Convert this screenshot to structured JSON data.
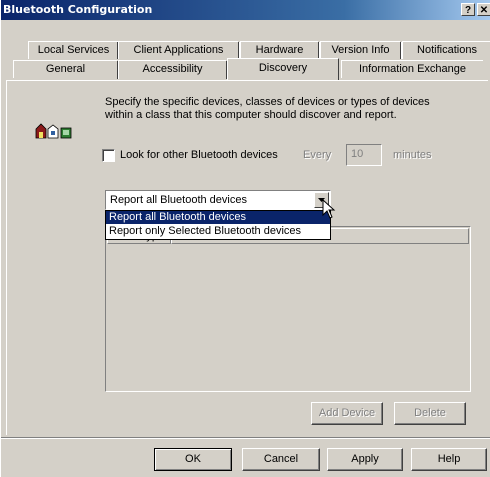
{
  "window": {
    "title": "Bluetooth Configuration",
    "help_glyph": "?",
    "close_glyph": "✕"
  },
  "tabs_top": [
    {
      "label": "Local Services"
    },
    {
      "label": "Client Applications"
    },
    {
      "label": "Hardware"
    },
    {
      "label": "Version Info"
    },
    {
      "label": "Notifications"
    }
  ],
  "tabs_bottom": [
    {
      "label": "General"
    },
    {
      "label": "Accessibility"
    },
    {
      "label": "Discovery"
    },
    {
      "label": "Information Exchange"
    }
  ],
  "selected_tab": "Discovery",
  "discovery": {
    "description": "Specify the specific devices, classes of devices or types of devices within a class that this computer should discover and report.",
    "look_for_label": "Look for other Bluetooth devices",
    "look_for_checked": false,
    "every_label": "Every",
    "every_value": "10",
    "minutes_label": "minutes",
    "dropdown_value": "Report all Bluetooth devices",
    "dropdown_options": [
      "Report all Bluetooth devices",
      "Report only Selected Bluetooth devices"
    ],
    "dropdown_open": true,
    "highlighted_option": 0,
    "list_columns": [
      "Filter Type",
      "Details"
    ],
    "add_device_label": "Add Device",
    "delete_label": "Delete"
  },
  "buttons": {
    "ok": "OK",
    "cancel": "Cancel",
    "apply": "Apply",
    "help": "Help"
  },
  "colors": {
    "title_bar": "#0a246a",
    "face": "#d4d0c8",
    "selection": "#0a246a"
  }
}
